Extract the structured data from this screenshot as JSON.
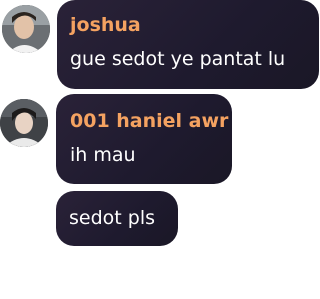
{
  "messages": [
    {
      "author": "joshua",
      "text": "gue sedot ye pantat lu",
      "avatar_icon": "user-avatar-icon"
    },
    {
      "author": "001 haniel awr",
      "text": "ih mau",
      "avatar_icon": "user-avatar-icon"
    },
    {
      "author": "001 haniel awr",
      "text": "sedot pls",
      "avatar_icon": ""
    }
  ],
  "colors": {
    "author_name": "#f4a261",
    "bubble_background": "#221c30",
    "message_text": "#ffffff"
  }
}
